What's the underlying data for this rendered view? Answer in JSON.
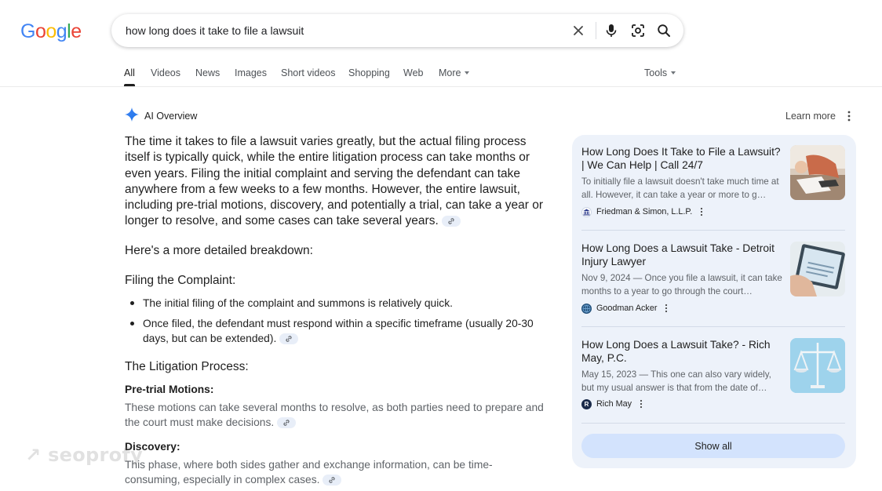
{
  "logo": {
    "letters": [
      "G",
      "o",
      "o",
      "g",
      "l",
      "e"
    ],
    "colors": [
      "#4285f4",
      "#ea4335",
      "#fbbc05",
      "#4285f4",
      "#34a853",
      "#ea4335"
    ]
  },
  "search": {
    "query": "how long does it take to file a lawsuit",
    "icons": [
      "close-icon",
      "mic-icon",
      "lens-icon",
      "search-icon"
    ]
  },
  "tabs": [
    {
      "label": "All",
      "active": true
    },
    {
      "label": "Videos"
    },
    {
      "label": "News"
    },
    {
      "label": "Images"
    },
    {
      "label": "Short videos"
    },
    {
      "label": "Shopping"
    },
    {
      "label": "Web"
    },
    {
      "label": "More"
    }
  ],
  "tools_label": "Tools",
  "ai_overview": {
    "label": "AI Overview",
    "learn_more": "Learn more",
    "intro": "The time it takes to file a lawsuit varies greatly, but the actual filing process itself is typically quick, while the entire litigation process can take months or even years. Filing the initial complaint and serving the defendant can take anywhere from a few weeks to a few months. However, the entire lawsuit, including pre-trial motions, discovery, and potentially a trial, can take a year or longer to resolve, and some cases can take several years.",
    "breakdown_heading": "Here's a more detailed breakdown:",
    "filing_heading": "Filing the Complaint:",
    "filing_bullets": [
      "The initial filing of the complaint and summons is relatively quick.",
      "Once filed, the defendant must respond within a specific timeframe (usually 20-30 days, but can be extended)."
    ],
    "litigation_heading": "The Litigation Process:",
    "pretrial_heading": "Pre-trial Motions:",
    "pretrial_text": "These motions can take several months to resolve, as both parties need to prepare and the court must make decisions.",
    "discovery_heading": "Discovery:",
    "discovery_text": "This phase, where both sides gather and exchange information, can be time-consuming, especially in complex cases."
  },
  "sources": [
    {
      "title": "How Long Does It Take to File a Lawsuit? | We Can Help | Call 24/7",
      "snippet": "To initially file a lawsuit doesn't take much time at all. However, it can take a year or more to g…",
      "source": "Friedman & Simon, L.L.P.",
      "icon": "bank-icon",
      "icon_color": "#2b3a8c"
    },
    {
      "title": "How Long Does a Lawsuit Take - Detroit Injury Lawyer",
      "snippet": "Nov 9, 2024 — Once you file a lawsuit, it can take months to a year to go through the court…",
      "source": "Goodman Acker",
      "icon": "globe-icon",
      "icon_color": "#1f4e79"
    },
    {
      "title": "How Long Does a Lawsuit Take? - Rich May, P.C.",
      "snippet": "May 15, 2023 — This one can also vary widely, but my usual answer is that from the date of…",
      "source": "Rich May",
      "icon": "r-logo-icon",
      "icon_color": "#1a2a4a",
      "icon_letter": "R"
    }
  ],
  "show_all": "Show all",
  "watermark": "seoprofy"
}
